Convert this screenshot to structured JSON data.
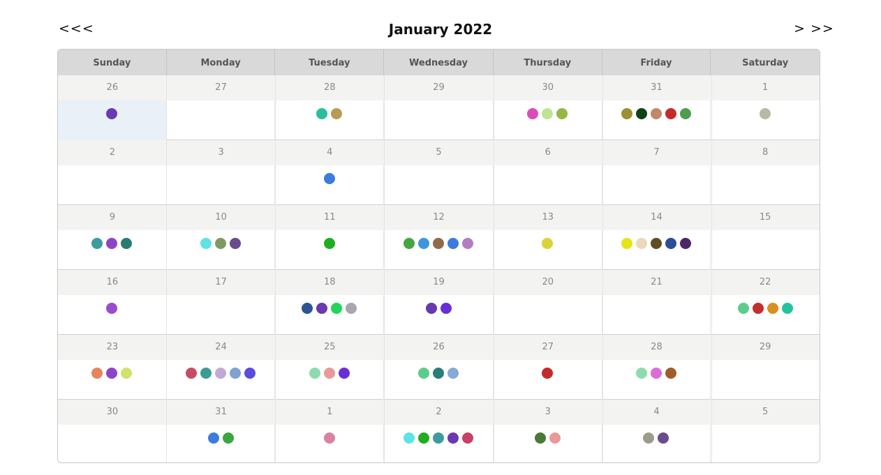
{
  "nav": {
    "prev_label": "<<<",
    "next_label": "> >>"
  },
  "title": "January 2022",
  "weekdays": [
    "Sunday",
    "Monday",
    "Tuesday",
    "Wednesday",
    "Thursday",
    "Friday",
    "Saturday"
  ],
  "today_index": 0,
  "weeks": [
    {
      "days": [
        {
          "num": "26",
          "dots": [
            "#6a3ab2"
          ]
        },
        {
          "num": "27",
          "dots": []
        },
        {
          "num": "28",
          "dots": [
            "#2abf9c",
            "#b89b52"
          ]
        },
        {
          "num": "29",
          "dots": []
        },
        {
          "num": "30",
          "dots": [
            "#dc4cb8",
            "#bde592",
            "#94b745"
          ]
        },
        {
          "num": "31",
          "dots": [
            "#9b9032",
            "#0e4316",
            "#c2886a",
            "#c52a2a",
            "#4f9d4f"
          ]
        },
        {
          "num": "1",
          "dots": [
            "#b7bba4"
          ]
        }
      ]
    },
    {
      "days": [
        {
          "num": "2",
          "dots": []
        },
        {
          "num": "3",
          "dots": []
        },
        {
          "num": "4",
          "dots": [
            "#3a7ddc"
          ]
        },
        {
          "num": "5",
          "dots": []
        },
        {
          "num": "6",
          "dots": []
        },
        {
          "num": "7",
          "dots": []
        },
        {
          "num": "8",
          "dots": []
        }
      ]
    },
    {
      "days": [
        {
          "num": "9",
          "dots": [
            "#3c9c9e",
            "#8d45c8",
            "#287d72"
          ]
        },
        {
          "num": "10",
          "dots": [
            "#5de3e3",
            "#7e9a62",
            "#684c8c"
          ]
        },
        {
          "num": "11",
          "dots": [
            "#1fae1f"
          ]
        },
        {
          "num": "12",
          "dots": [
            "#46a642",
            "#3f96de",
            "#8f6a4a",
            "#3a7ddc",
            "#b27ec0"
          ]
        },
        {
          "num": "13",
          "dots": [
            "#d9d33a"
          ]
        },
        {
          "num": "14",
          "dots": [
            "#e4e418",
            "#ecd9b8",
            "#5f4e25",
            "#2a4e9a",
            "#4e2666"
          ]
        },
        {
          "num": "15",
          "dots": []
        }
      ]
    },
    {
      "days": [
        {
          "num": "16",
          "dots": [
            "#9b4ccc"
          ]
        },
        {
          "num": "17",
          "dots": []
        },
        {
          "num": "18",
          "dots": [
            "#2c5596",
            "#6a38b0",
            "#22d65c",
            "#aaa6b0"
          ]
        },
        {
          "num": "19",
          "dots": [
            "#6a38b0",
            "#6a2ed8"
          ]
        },
        {
          "num": "20",
          "dots": []
        },
        {
          "num": "21",
          "dots": []
        },
        {
          "num": "22",
          "dots": [
            "#5ccc8c",
            "#c42e2e",
            "#d9901e",
            "#22c4a0"
          ]
        }
      ]
    },
    {
      "days": [
        {
          "num": "23",
          "dots": [
            "#e8845c",
            "#8d45c8",
            "#d2e26a"
          ]
        },
        {
          "num": "24",
          "dots": [
            "#c84a64",
            "#3c9c94",
            "#c2a8d4",
            "#7ea2d2",
            "#5a4cdc"
          ]
        },
        {
          "num": "25",
          "dots": [
            "#8cdcae",
            "#e89a9a",
            "#6a2ed8"
          ]
        },
        {
          "num": "26",
          "dots": [
            "#5ccc8c",
            "#2a7d7a",
            "#86aad6"
          ]
        },
        {
          "num": "27",
          "dots": [
            "#c52a2a"
          ]
        },
        {
          "num": "28",
          "dots": [
            "#8cdcae",
            "#dc6cd8",
            "#a05c2a"
          ]
        },
        {
          "num": "29",
          "dots": []
        }
      ]
    },
    {
      "days": [
        {
          "num": "30",
          "dots": []
        },
        {
          "num": "31",
          "dots": [
            "#3a7ddc",
            "#3aa640"
          ]
        },
        {
          "num": "1",
          "dots": [
            "#d882a4"
          ]
        },
        {
          "num": "2",
          "dots": [
            "#5de3e3",
            "#1fae1f",
            "#3c9c9e",
            "#6a38b0",
            "#c8406a"
          ]
        },
        {
          "num": "3",
          "dots": [
            "#4a7a34",
            "#e89a9a"
          ]
        },
        {
          "num": "4",
          "dots": [
            "#9c9c8c",
            "#684c8c"
          ]
        },
        {
          "num": "5",
          "dots": []
        }
      ]
    }
  ]
}
